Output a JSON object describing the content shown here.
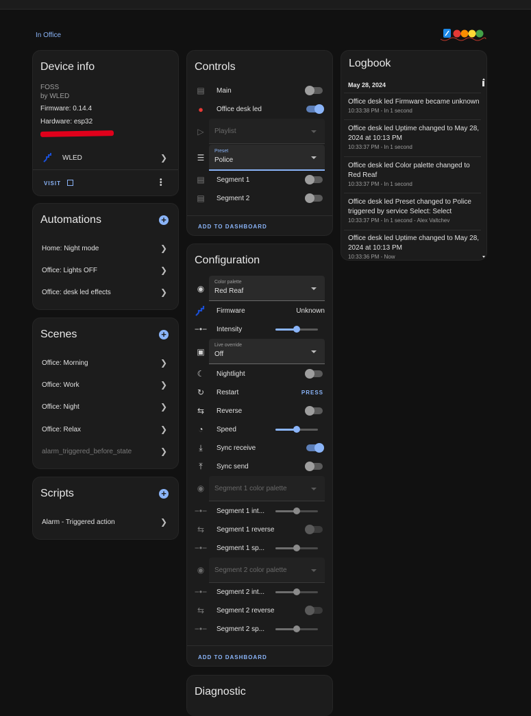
{
  "area": {
    "name": "In Office"
  },
  "device_info": {
    "title": "Device info",
    "model": "FOSS",
    "manufacturer": "by WLED",
    "firmware": "Firmware: 0.14.4",
    "hardware": "Hardware: esp32",
    "integration": "WLED",
    "visit_label": "VISIT"
  },
  "automations": {
    "title": "Automations",
    "items": [
      "Home: Night mode",
      "Office: Lights OFF",
      "Office: desk led effects"
    ]
  },
  "scenes": {
    "title": "Scenes",
    "items": [
      "Office: Morning",
      "Office: Work",
      "Office: Night",
      "Office: Relax",
      "alarm_triggered_before_state"
    ]
  },
  "scripts": {
    "title": "Scripts",
    "items": [
      "Alarm - Triggered action"
    ]
  },
  "controls": {
    "title": "Controls",
    "main": "Main",
    "office_desk_led": "Office desk led",
    "playlist": "Playlist",
    "preset_label": "Preset",
    "preset_value": "Police",
    "segment1": "Segment 1",
    "segment2": "Segment 2",
    "add_to_dashboard": "ADD TO DASHBOARD"
  },
  "configuration": {
    "title": "Configuration",
    "color_palette_label": "Color palette",
    "color_palette_value": "Red Reaf",
    "firmware": "Firmware",
    "firmware_value": "Unknown",
    "intensity": "Intensity",
    "intensity_level": 0.5,
    "live_override_label": "Live override",
    "live_override_value": "Off",
    "nightlight": "Nightlight",
    "restart": "Restart",
    "press_label": "PRESS",
    "reverse": "Reverse",
    "speed": "Speed",
    "speed_level": 0.5,
    "sync_receive": "Sync receive",
    "sync_send": "Sync send",
    "segment1_color_palette": "Segment 1 color palette",
    "segment1_intensity": "Segment 1 int...",
    "segment1_reverse": "Segment 1 reverse",
    "segment1_speed": "Segment 1 sp...",
    "segment2_color_palette": "Segment 2 color palette",
    "segment2_intensity": "Segment 2 int...",
    "segment2_reverse": "Segment 2 reverse",
    "segment2_speed": "Segment 2 sp...",
    "add_to_dashboard": "ADD TO DASHBOARD"
  },
  "diagnostic": {
    "title": "Diagnostic"
  },
  "logbook": {
    "title": "Logbook",
    "date": "May 28, 2024",
    "entries": [
      {
        "text": "Office desk led Firmware became unknown",
        "meta": "10:33:38 PM - In 1 second"
      },
      {
        "text": "Office desk led Uptime changed to May 28, 2024 at 10:13 PM",
        "meta": "10:33:37 PM - In 1 second"
      },
      {
        "text": "Office desk led Color palette changed to Red Reaf",
        "meta": "10:33:37 PM - In 1 second"
      },
      {
        "text": "Office desk led Preset changed to Police triggered by service Select: Select",
        "meta": "10:33:37 PM - In 1 second - Alex Valtchev"
      },
      {
        "text": "Office desk led Uptime changed to May 28, 2024 at 10:13 PM",
        "meta": "10:33:36 PM - Now"
      }
    ]
  },
  "colors": {
    "accent": "#8ab4f8",
    "card": "#1c1c1c",
    "background": "#111111",
    "wled_blue": "#1a4fd6",
    "led_red": "#e53935"
  }
}
